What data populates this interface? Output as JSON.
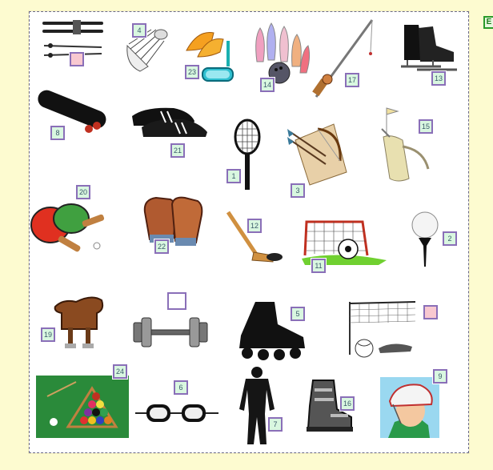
{
  "corner_button": {
    "label": "E",
    "icon": "green-square-icon"
  },
  "items": [
    {
      "name": "skis",
      "box": ""
    },
    {
      "name": "shuttlecock",
      "box": "4"
    },
    {
      "name": "flippers-snorkel",
      "box": "23"
    },
    {
      "name": "bowling",
      "box": "14"
    },
    {
      "name": "fishing-rod",
      "box": "17"
    },
    {
      "name": "ice-skates",
      "box": "13"
    },
    {
      "name": "skateboard",
      "box": "8"
    },
    {
      "name": "football-boots",
      "box": "21"
    },
    {
      "name": "tennis-racket",
      "box": "1"
    },
    {
      "name": "bow-arrows",
      "box": "3"
    },
    {
      "name": "golf-bag",
      "box": "15"
    },
    {
      "name": "ping-pong",
      "box": "20"
    },
    {
      "name": "boxing-gloves",
      "box": "22"
    },
    {
      "name": "hockey-stick",
      "box": "12"
    },
    {
      "name": "soccer-goal",
      "box": "11"
    },
    {
      "name": "golf-ball",
      "box": "2"
    },
    {
      "name": "saddle",
      "box": "19"
    },
    {
      "name": "dumbbell",
      "box": ""
    },
    {
      "name": "inline-skate",
      "box": "5"
    },
    {
      "name": "volleyball-net",
      "box": ""
    },
    {
      "name": "billiards",
      "box": "24"
    },
    {
      "name": "goggles",
      "box": "6"
    },
    {
      "name": "wetsuit",
      "box": "7"
    },
    {
      "name": "ski-boot",
      "box": "16"
    },
    {
      "name": "helmet",
      "box": "9"
    }
  ],
  "colors": {
    "background": "#fdfbd0",
    "box_fill": "#d9f7e0",
    "box_border": "#8a6fb8",
    "box_pink": "#f8c8d0"
  }
}
